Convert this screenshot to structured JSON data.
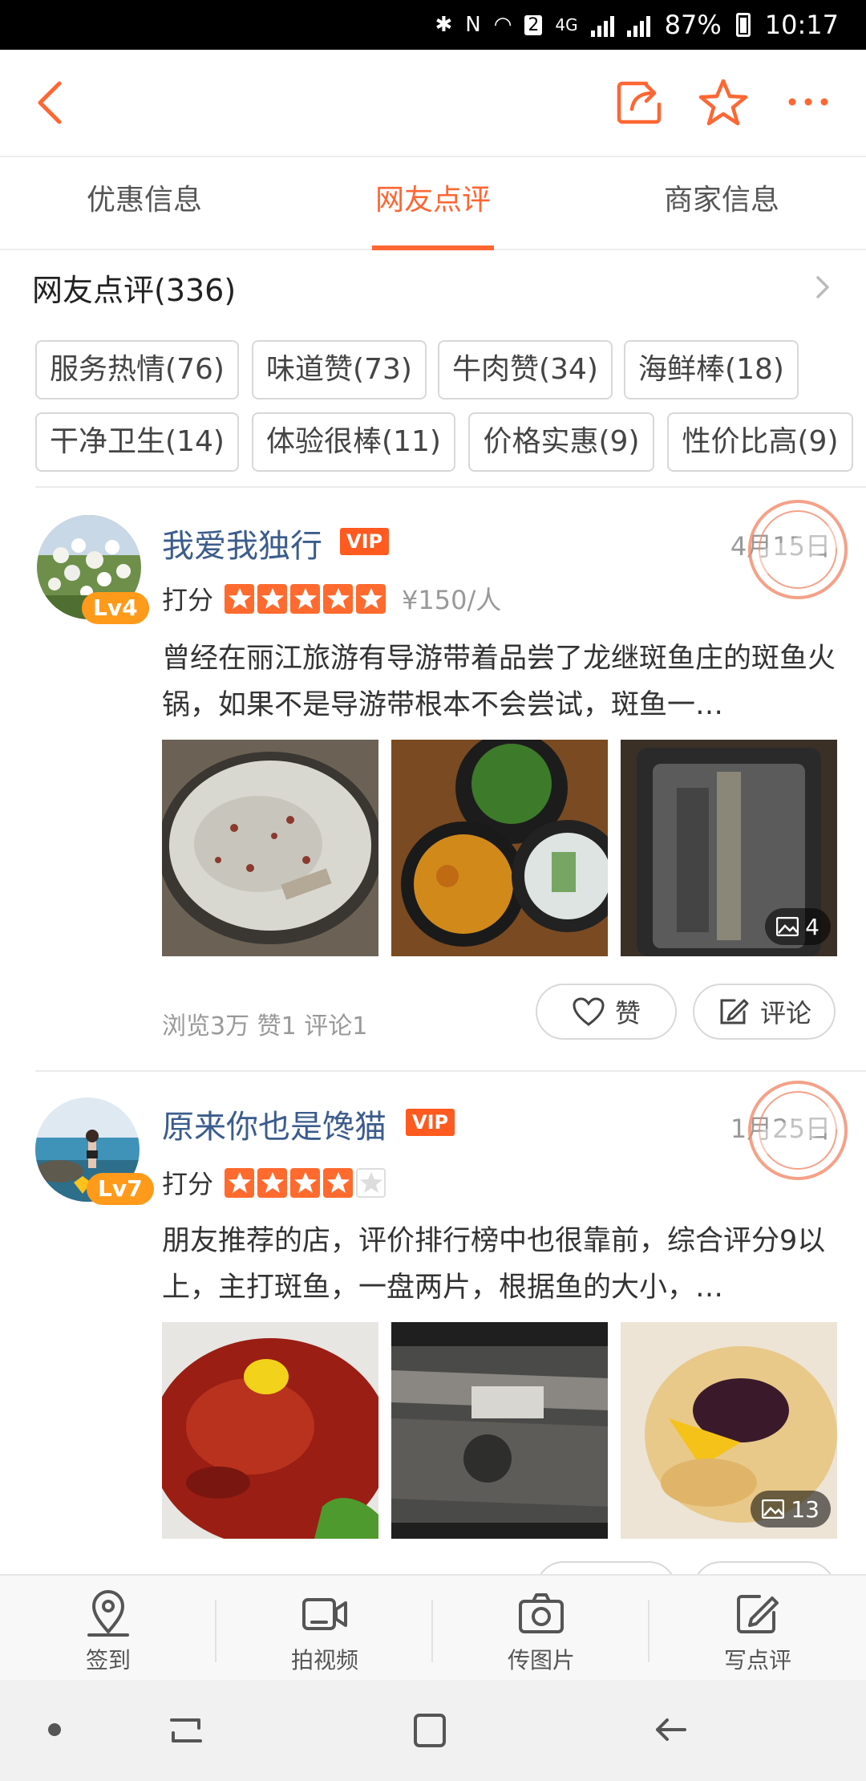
{
  "status_bar": {
    "battery": "87%",
    "time": "10:17",
    "network": "4G",
    "sim": "2"
  },
  "tabs": [
    {
      "label": "优惠信息",
      "active": false
    },
    {
      "label": "网友点评",
      "active": true
    },
    {
      "label": "商家信息",
      "active": false
    }
  ],
  "reviews_section": {
    "title": "网友点评(336)",
    "tags": [
      "服务热情(76)",
      "味道赞(73)",
      "牛肉赞(34)",
      "海鲜棒(18)",
      "干净卫生(14)",
      "体验很棒(11)",
      "价格实惠(9)",
      "性价比高(9)"
    ]
  },
  "reviews": [
    {
      "user": "我爱我独行",
      "level": "Lv4",
      "vip": "VIP",
      "date": "4月15日",
      "score_label": "打分",
      "stars": 5,
      "price": "¥150/人",
      "text": "曾经在丽江旅游有导游带着品尝了龙继斑鱼庄的斑鱼火锅，如果不是导游带根本不会尝试，斑鱼一…",
      "image_count": "4",
      "stats": "浏览3万 赞1 评论1",
      "like_label": "赞",
      "comment_label": "评论"
    },
    {
      "user": "原来你也是馋猫",
      "level": "Lv7",
      "vip": "VIP",
      "date": "1月25日",
      "score_label": "打分",
      "stars": 4,
      "text": "朋友推荐的店，评价排行榜中也很靠前，综合评分9以上，主打斑鱼，一盘两片，根据鱼的大小，…",
      "image_count": "13"
    }
  ],
  "bottom_bar": [
    {
      "label": "签到",
      "icon": "location-pin-icon"
    },
    {
      "label": "拍视频",
      "icon": "video-camera-icon"
    },
    {
      "label": "传图片",
      "icon": "photo-upload-icon"
    },
    {
      "label": "写点评",
      "icon": "write-review-icon"
    }
  ],
  "colors": {
    "accent": "#ff6633",
    "username": "#3b5c8d",
    "vip": "#ff5a1f",
    "level_badge": "#ff9a1a"
  }
}
